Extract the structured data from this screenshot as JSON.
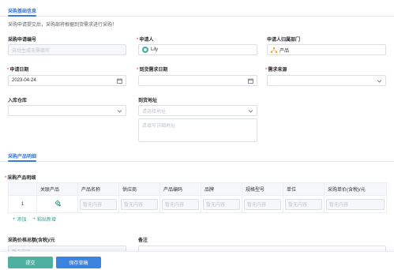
{
  "basic": {
    "section_title": "采购基础信息",
    "note": "采购申请提交后，采购部将根据到货需求进行采购！",
    "request_no": {
      "label": "采购申请编号",
      "placeholder": "自动生成无需填写"
    },
    "applicant": {
      "label": "申请人",
      "required": "*",
      "value": "Lily"
    },
    "department": {
      "label": "申请人归属部门",
      "value": "产品"
    },
    "apply_date": {
      "label": "申请日期",
      "required": "*",
      "value": "2023-04-24"
    },
    "arrival_date": {
      "label": "到货需求日期",
      "required": "*",
      "value": ""
    },
    "demand_source": {
      "label": "需求来源",
      "required": "*",
      "value": ""
    },
    "warehouse": {
      "label": "入库仓库",
      "value": ""
    },
    "address": {
      "label": "到货地址",
      "select_placeholder": "请选择地址",
      "detail_placeholder": "请填写详细地址"
    }
  },
  "products": {
    "section_title": "采购产品明细",
    "table_label": "采购产品明细",
    "required": "*",
    "columns": [
      "",
      "关联产品",
      "产品名称",
      "供应商",
      "产品编码",
      "品牌",
      "规格型号",
      "单位",
      "采购单价(含税)/元"
    ],
    "rows": [
      {
        "index": "1",
        "name": "暂无内容",
        "supplier": "暂无内容",
        "code": "暂无内容",
        "brand": "暂无内容",
        "spec": "暂无内容",
        "unit": "暂无内容",
        "price": "暂无内容"
      }
    ],
    "add_label": "添加",
    "paste_label": "粘贴新增"
  },
  "totals": {
    "total_label": "采购价格总额(含税)/元",
    "total_placeholder": "暂无内容",
    "remark_label": "备注"
  },
  "footer": {
    "submit_label": "提交",
    "draft_label": "保存草稿"
  },
  "colors": {
    "accent": "#3a7bd5",
    "submit": "#4fb0a1",
    "draft": "#3a84e0",
    "required": "#f56c6c"
  },
  "icons": {
    "calendar": "calendar-icon",
    "chevron": "chevron-down-icon",
    "product_link": "link-product-icon",
    "add": "plus-icon"
  }
}
